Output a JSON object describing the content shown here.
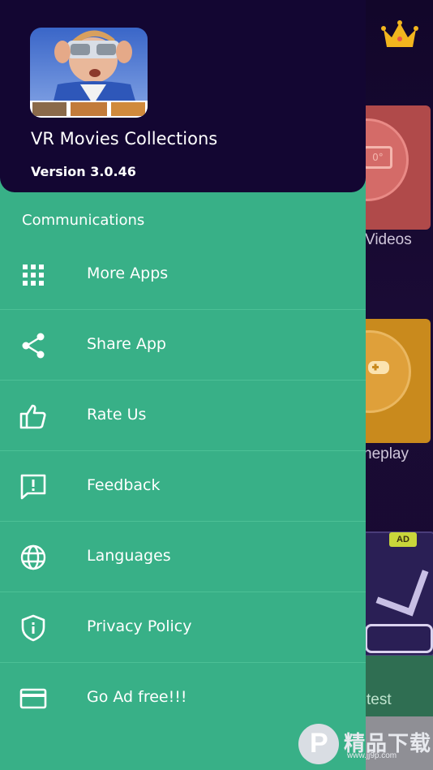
{
  "colors": {
    "drawer_bg": "#38b087",
    "header_bg": "#130632",
    "divider": "#4cc096",
    "text": "#ffffff"
  },
  "header": {
    "app_name": "VR Movies Collections",
    "version": "Version 3.0.46"
  },
  "section": {
    "title": "Communications"
  },
  "menu": [
    {
      "label": "More Apps",
      "icon": "grid-icon"
    },
    {
      "label": "Share App",
      "icon": "share-icon"
    },
    {
      "label": "Rate Us",
      "icon": "thumbs-up-icon"
    },
    {
      "label": "Feedback",
      "icon": "feedback-icon"
    },
    {
      "label": "Languages",
      "icon": "globe-icon"
    },
    {
      "label": "Privacy Policy",
      "icon": "shield-icon"
    },
    {
      "label": "Go Ad free!!!",
      "icon": "credit-card-icon"
    }
  ],
  "background_app": {
    "tile_videos_label": "Videos",
    "tile_game_label": "neplay",
    "ad_badge": "AD",
    "bottom_label": "test"
  },
  "watermark": {
    "text": "精品下载",
    "sub": "www.jj9p.com"
  }
}
